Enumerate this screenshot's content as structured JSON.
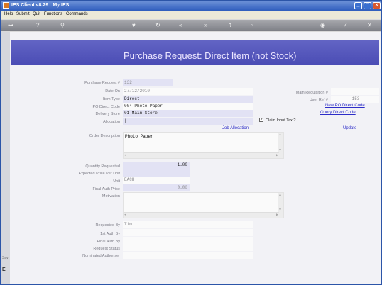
{
  "window": {
    "title": "IES Client v8.29 : My IES"
  },
  "menu": [
    "Help",
    "Submit",
    "Quit",
    "Functions",
    "Commands"
  ],
  "header": {
    "title": "Purchase Request: Direct Item (not Stock)"
  },
  "sidebar": {
    "label1": "Sav",
    "label2": "E"
  },
  "labels": {
    "purchase_request": "Purchase Request #",
    "date_on": "Date-On",
    "item_type": "Item Type",
    "po_direct_code": "PO Direct Code",
    "delivery_store": "Delivery Store",
    "allocation": "Allocation",
    "order_description": "Order Description",
    "quantity_requested": "Quantity Requested",
    "expected_price": "Expected Price Per Unit",
    "unit": "Unit",
    "final_auth_price": "Final Auth Price",
    "motivation": "Motivation",
    "requested_by": "Requested By",
    "first_auth_by": "1st Auth By",
    "final_auth_by": "Final Auth By",
    "request_status": "Request Status",
    "nominated_authoriser": "Nominated Authoriser",
    "main_requisition": "Main Requisition #",
    "user_ref": "User Ref #",
    "claim_input_tax": "Claim Input Tax ?"
  },
  "values": {
    "purchase_request": "132",
    "date_on": "27/12/2010",
    "item_type": "Direct",
    "po_direct_code": "004 Photo Paper",
    "delivery_store": "01 Main Store",
    "order_description": "Photo Paper",
    "quantity_requested": "1.00",
    "unit": "EACH",
    "final_auth_price": "0.00",
    "requested_by": "Tim",
    "user_ref": "153"
  },
  "links": {
    "job_allocation": "Job Allocation",
    "new_po_direct_code": "New PO Direct Code",
    "query_direct_code": "Query Direct Code",
    "update": "Update"
  }
}
